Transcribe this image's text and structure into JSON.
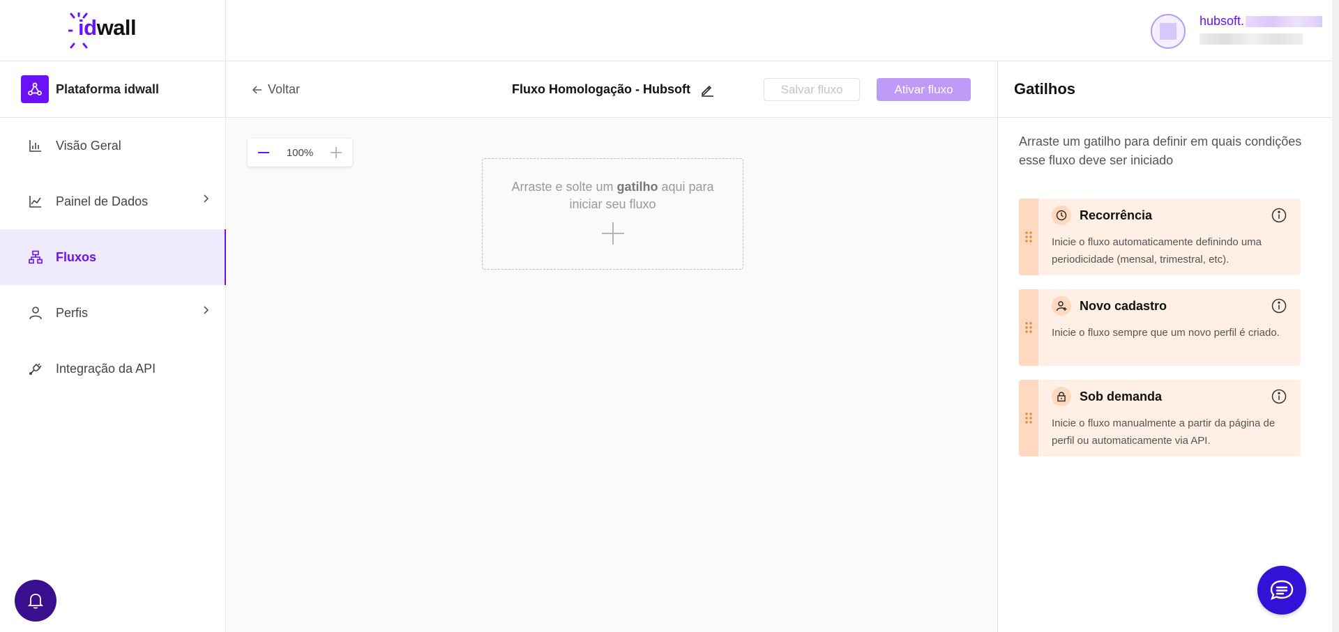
{
  "brand": {
    "logo_id": "id",
    "logo_wall": "wall",
    "accent": "#6a11f5"
  },
  "header": {
    "username": "hubsoft."
  },
  "sidebar": {
    "platform_label": "Plataforma idwall",
    "items": [
      {
        "label": "Visão Geral",
        "icon": "bar-chart-icon",
        "active": false,
        "expandable": false
      },
      {
        "label": "Painel de Dados",
        "icon": "line-chart-icon",
        "active": false,
        "expandable": true
      },
      {
        "label": "Fluxos",
        "icon": "flow-icon",
        "active": true,
        "expandable": false
      },
      {
        "label": "Perfis",
        "icon": "user-icon",
        "active": false,
        "expandable": true
      },
      {
        "label": "Integração da API",
        "icon": "plug-icon",
        "active": false,
        "expandable": false
      }
    ]
  },
  "toolbar": {
    "back_label": "Voltar",
    "flow_title": "Fluxo Homologação - Hubsoft",
    "save_label": "Salvar fluxo",
    "activate_label": "Ativar fluxo"
  },
  "canvas": {
    "zoom_value": "100%",
    "drop_text_before": "Arraste e solte um ",
    "drop_text_bold": "gatilho",
    "drop_text_after": " aqui para iniciar seu fluxo"
  },
  "panel": {
    "title": "Gatilhos",
    "description": "Arraste um gatilho para definir em quais condições esse fluxo deve ser iniciado",
    "triggers": [
      {
        "title": "Recorrência",
        "icon": "clock-icon",
        "description": "Inicie o fluxo automaticamente definindo uma periodicidade (mensal, trimestral, etc)."
      },
      {
        "title": "Novo cadastro",
        "icon": "new-user-icon",
        "description": "Inicie o fluxo sempre que um novo perfil é criado."
      },
      {
        "title": "Sob demanda",
        "icon": "lock-icon",
        "description": "Inicie o fluxo manualmente a partir da página de perfil ou automaticamente via API."
      }
    ]
  }
}
